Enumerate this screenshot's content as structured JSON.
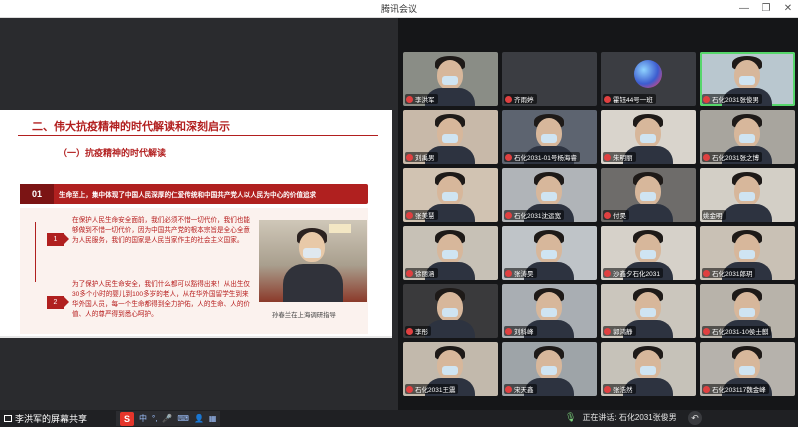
{
  "window": {
    "title": "腾讯会议",
    "controls": [
      "minimize",
      "restore",
      "close"
    ]
  },
  "slide": {
    "heading": "二、伟大抗疫精神的时代解读和深刻启示",
    "subheading": "（一）抗疫精神的时代解读",
    "band_number": "01",
    "band_text": "生命至上，集中体现了中国人民深厚的仁爱传统和中国共产党人以人民为中心的价值追求",
    "steps": [
      "1",
      "2"
    ],
    "paragraph_1": "在保护人民生命安全面前，我们必须不惜一切代价，我们也能够做到不惜一切代价，因为中国共产党的根本宗旨是全心全意为人民服务，我们的国家是人民当家作主的社会主义国家。",
    "paragraph_2": "为了保护人民生命安全，我们什么都可以豁得出来！从出生仅30多个小时的婴儿到100多岁的老人，从在华外国留学生到来华外国人员，每一个生命都得到全力护佑，人的生命、人的价值、人的尊严得到悉心呵护。",
    "photo_caption": "孙春兰在上海调研指导"
  },
  "bottom_bar": {
    "share_label": "李洪军的屏幕共享",
    "ime_logo": "S",
    "ime_items": [
      "中",
      "°,",
      "🎤",
      "⌨",
      "👤",
      "▦"
    ],
    "speaking_label": "正在讲话: 石化2031张俊男",
    "back_icon": "↶"
  },
  "participants": [
    {
      "name": "李洪军",
      "muted": true,
      "type": "video",
      "bg": "#8a8d86"
    },
    {
      "name": "齐雨婷",
      "muted": true,
      "type": "empty",
      "bg": "#3b3d42"
    },
    {
      "name": "霍钰44号一班",
      "muted": true,
      "type": "avatar",
      "bg": "#3b3d42"
    },
    {
      "name": "石化2031张俊男",
      "muted": true,
      "type": "video",
      "bg": "#b9c7cf",
      "active": true
    },
    {
      "name": "刘禹男",
      "muted": true,
      "type": "video",
      "bg": "#c8b9a9"
    },
    {
      "name": "石化2031-01号杨海睿",
      "muted": true,
      "type": "video",
      "bg": "#5d6470"
    },
    {
      "name": "朱明丽",
      "muted": true,
      "type": "video",
      "bg": "#d9d4cc"
    },
    {
      "name": "石化2031张之博",
      "muted": true,
      "type": "video",
      "bg": "#a8a59e"
    },
    {
      "name": "张美慧",
      "muted": true,
      "type": "video",
      "bg": "#d1c3b2"
    },
    {
      "name": "石化2031沈运宽",
      "muted": true,
      "type": "video",
      "bg": "#b0b4b8"
    },
    {
      "name": "付昊",
      "muted": true,
      "type": "video",
      "bg": "#6e6c6a"
    },
    {
      "name": "姚金明",
      "muted": false,
      "type": "video",
      "bg": "#d3cfc6"
    },
    {
      "name": "徐丽涵",
      "muted": true,
      "type": "video",
      "bg": "#c7c1b6"
    },
    {
      "name": "张涛昊",
      "muted": true,
      "type": "video",
      "bg": "#bfc4c8"
    },
    {
      "name": "沙鑫夕石化2031",
      "muted": true,
      "type": "video",
      "bg": "#d6d1c9"
    },
    {
      "name": "石化2031郎玥",
      "muted": true,
      "type": "video",
      "bg": "#c9c1b5"
    },
    {
      "name": "李彤",
      "muted": true,
      "type": "video",
      "bg": "#3a3a3c"
    },
    {
      "name": "刘科峰",
      "muted": true,
      "type": "video",
      "bg": "#a9aeb3"
    },
    {
      "name": "郭鸿静",
      "muted": true,
      "type": "video",
      "bg": "#cbc6bd"
    },
    {
      "name": "石化2031-10侯士麒",
      "muted": true,
      "type": "video",
      "bg": "#b8b3aa"
    },
    {
      "name": "石化2031王震",
      "muted": true,
      "type": "video",
      "bg": "#c2b9ac"
    },
    {
      "name": "宋天鑫",
      "muted": true,
      "type": "video",
      "bg": "#9ea4a8"
    },
    {
      "name": "张浩然",
      "muted": true,
      "type": "video",
      "bg": "#c6c2b9"
    },
    {
      "name": "石化203117魏金峰",
      "muted": true,
      "type": "video",
      "bg": "#b6b2ac"
    }
  ]
}
